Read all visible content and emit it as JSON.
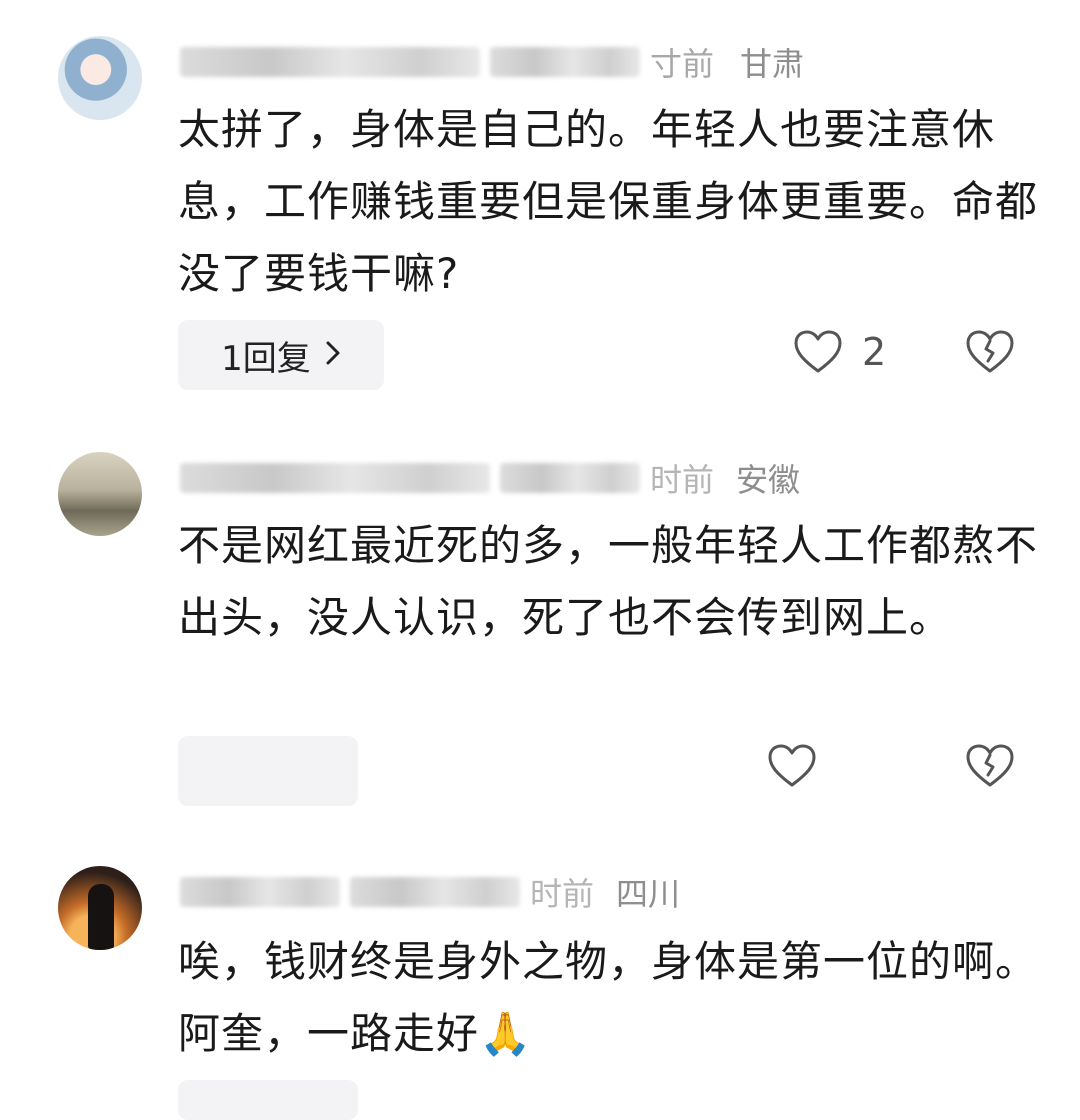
{
  "comments": [
    {
      "time_partial": "寸前",
      "location": "甘肃",
      "text": "太拼了，身体是自己的。年轻人也要注意休息，工作赚钱重要但是保重身体更重要。命都没了要钱干嘛?",
      "reply_label": "1回复",
      "likes": "2"
    },
    {
      "time_partial": "时前",
      "location": "安徽",
      "text": "不是网红最近死的多，一般年轻人工作都熬不出头，没人认识，死了也不会传到网上。",
      "reply_label": "",
      "likes": ""
    },
    {
      "time_partial": "时前",
      "location": "四川",
      "text": "唉，钱财终是身外之物，身体是第一位的啊。阿奎，一路走好",
      "emoji": "🙏"
    }
  ],
  "icons": {
    "like": "heart-outline-icon",
    "dislike": "broken-heart-icon",
    "chevron": "chevron-right-icon"
  },
  "colors": {
    "meta": "#8e8e8e",
    "pill": "#f3f3f5",
    "text": "#1a1a1a"
  }
}
